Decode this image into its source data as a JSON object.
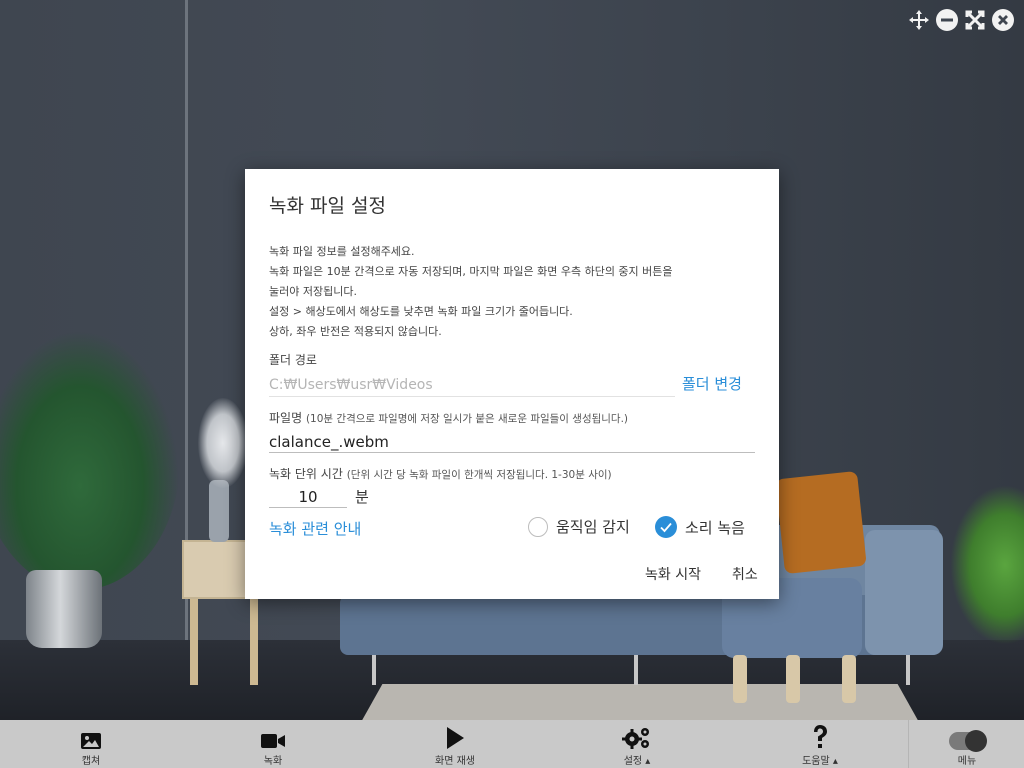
{
  "window_controls": [
    {
      "name": "move",
      "icon": "move-icon"
    },
    {
      "name": "minimize",
      "icon": "minimize-icon"
    },
    {
      "name": "fullscreen",
      "icon": "fullscreen-icon"
    },
    {
      "name": "close",
      "icon": "close-icon"
    }
  ],
  "dialog": {
    "title": "녹화 파일 설정",
    "description": [
      "녹화 파일 정보를 설정해주세요.",
      "녹화 파일은 10분 간격으로 자동 저장되며, 마지막 파일은 화면 우측 하단의 중지 버튼을",
      "눌러야 저장됩니다.",
      "설정 > 해상도에서 해상도를 낮추면 녹화 파일 크기가 줄어듭니다.",
      "상하, 좌우 반전은 적용되지 않습니다."
    ],
    "folder_label": "폴더 경로",
    "folder_path": "C:₩Users₩usr₩Videos",
    "folder_change": "폴더 변경",
    "filename_label": "파일명",
    "filename_hint": "(10분 간격으로 파일명에 저장 일시가 붙은 새로운 파일들이 생성됩니다.)",
    "filename_value": "clalance_.webm",
    "unit_label": "녹화 단위 시간",
    "unit_hint": "(단위 시간 당 녹화 파일이 한개씩 저장됩니다. 1-30분 사이)",
    "unit_value": "10",
    "unit_suffix": "분",
    "guide_link": "녹화 관련 안내",
    "motion_label": "움직임 감지",
    "motion_checked": false,
    "sound_label": "소리 녹음",
    "sound_checked": true,
    "start_button": "녹화 시작",
    "cancel_button": "취소"
  },
  "toolbar": {
    "capture": "캡쳐",
    "record": "녹화",
    "play": "화면 재생",
    "settings": "설정 ▴",
    "help": "도움말 ▴",
    "menu": "메뉴"
  },
  "colors": {
    "accent": "#2a8ed8",
    "toolbar_bg": "#c9c9c9",
    "dialog_bg": "#ffffff"
  }
}
